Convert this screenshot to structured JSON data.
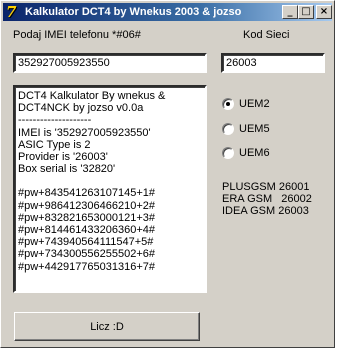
{
  "window": {
    "title": "Kalkulator DCT4 by Wnekus 2003 & jozso",
    "icon_glyph": "7",
    "minimize_glyph": "_",
    "maximize_glyph": "□",
    "close_glyph": "×"
  },
  "imei": {
    "label": "Podaj IMEI telefonu *#06#",
    "value": "352927005923550"
  },
  "network_code": {
    "label": "Kod Sieci",
    "value": "26003"
  },
  "output": {
    "lines": [
      "DCT4 Kalkulator By wnekus &",
      "DCT4NCK by jozso v0.0a",
      "--------------------",
      "IMEI is '352927005923550'",
      "ASIC Type is 2",
      "Provider is '26003'",
      "Box serial is '32820'",
      "",
      "#pw+843541263107145+1#",
      "#pw+986412306466210+2#",
      "#pw+832821653000121+3#",
      "#pw+814461433206360+4#",
      "#pw+743940564111547+5#",
      "#pw+734300556255502+6#",
      "#pw+442917765031316+7#"
    ]
  },
  "uem_options": [
    {
      "label": "UEM2",
      "selected": true
    },
    {
      "label": "UEM5",
      "selected": false
    },
    {
      "label": "UEM6",
      "selected": false
    }
  ],
  "networks": [
    "PLUSGSM 26001",
    "ERA GSM   26002",
    "IDEA GSM 26003"
  ],
  "calculate_button": {
    "label": "Licz :D"
  }
}
